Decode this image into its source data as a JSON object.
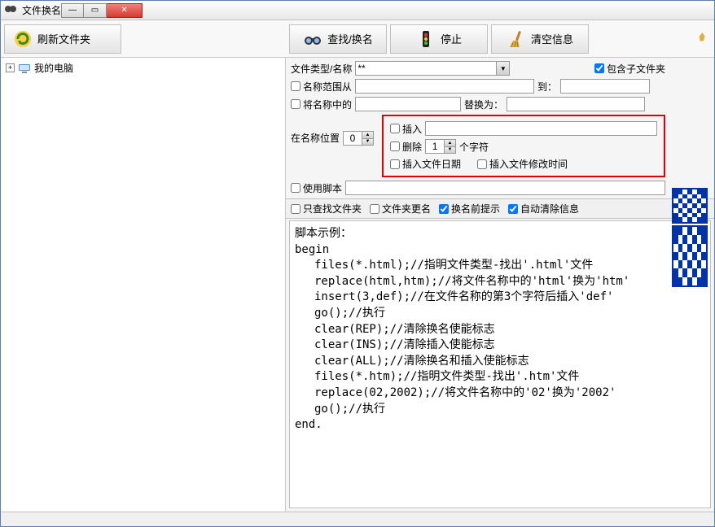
{
  "window": {
    "title": "文件换名"
  },
  "toolbar": {
    "refresh": "刷新文件夹",
    "find_replace": "查找/换名",
    "stop": "停止",
    "clear": "清空信息"
  },
  "tree": {
    "root": "我的电脑"
  },
  "options": {
    "filetype_label": "文件类型/名称",
    "filetype_value": "**",
    "include_sub": "包含子文件夹",
    "include_sub_checked": true,
    "range_from_label": "名称范围从",
    "range_to_label": "到：",
    "replace_in_label": "将名称中的",
    "replace_with_label": "替换为：",
    "at_pos_label": "在名称位置",
    "at_pos_value": "0",
    "insert_label": "插入",
    "delete_label": "删除",
    "delete_count": "1",
    "chars_label": "个字符",
    "insert_date": "插入文件日期",
    "insert_mtime": "插入文件修改时间",
    "use_script": "使用脚本"
  },
  "checkrow": {
    "only_folders": "只查找文件夹",
    "rename_folders": "文件夹更名",
    "prompt": "换名前提示",
    "prompt_checked": true,
    "autoclear": "自动清除信息",
    "autoclear_checked": true
  },
  "script": {
    "title": "脚本示例：",
    "begin": "begin",
    "l1": "files(*.html);//指明文件类型-找出'.html'文件",
    "l2": "replace(html,htm);//将文件名称中的'html'换为'htm'",
    "l3": "insert(3,def);//在文件名称的第3个字符后插入'def'",
    "l4": "go();//执行",
    "l5": "clear(REP);//清除换名使能标志",
    "l6": "clear(INS);//清除插入使能标志",
    "l7": "clear(ALL);//清除换名和插入使能标志",
    "l8": "files(*.htm);//指明文件类型-找出'.htm'文件",
    "l9": "replace(02,2002);//将文件名称中的'02'换为'2002'",
    "l10": "go();//执行",
    "end": "end."
  }
}
